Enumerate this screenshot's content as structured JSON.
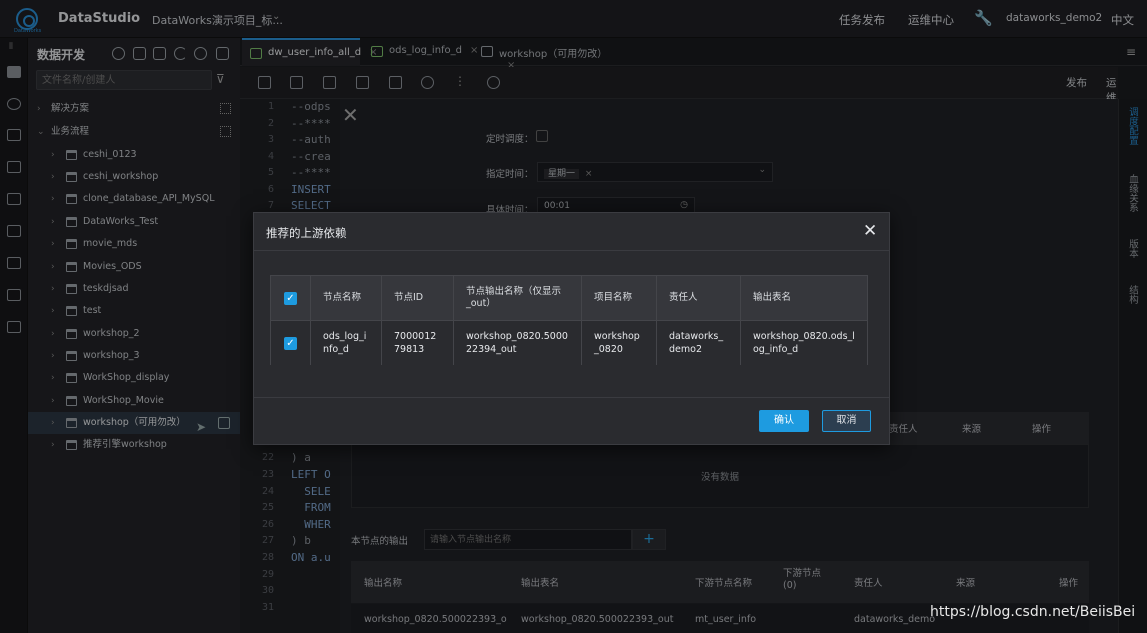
{
  "topbar": {
    "logo_sub": "DataWorks",
    "app_name": "DataStudio",
    "project": "DataWorks演示项目_标...",
    "nav_publish": "任务发布",
    "nav_ops": "运维中心",
    "user": "dataworks_demo2",
    "lang": "中文"
  },
  "sidebar": {
    "title": "数据开发",
    "search_placeholder": "文件名称/创建人",
    "groups": [
      {
        "label": "解决方案"
      },
      {
        "label": "业务流程"
      }
    ],
    "items": [
      {
        "label": "ceshi_0123"
      },
      {
        "label": "ceshi_workshop"
      },
      {
        "label": "clone_database_API_MySQL"
      },
      {
        "label": "DataWorks_Test"
      },
      {
        "label": "movie_mds"
      },
      {
        "label": "Movies_ODS"
      },
      {
        "label": "teskdjsad"
      },
      {
        "label": "test"
      },
      {
        "label": "workshop_2"
      },
      {
        "label": "workshop_3"
      },
      {
        "label": "WorkShop_display"
      },
      {
        "label": "WorkShop_Movie"
      },
      {
        "label": "workshop（可用勿改）"
      },
      {
        "label": "推荐引擎workshop"
      }
    ]
  },
  "tabs": [
    {
      "label": "dw_user_info_all_d"
    },
    {
      "label": "ods_log_info_d"
    },
    {
      "label": "workshop（可用勿改）"
    }
  ],
  "toolbar": {
    "publish": "发布",
    "ops": "运维"
  },
  "editor": {
    "line_numbers": [
      "1",
      "2",
      "3",
      "4",
      "5",
      "6",
      "7",
      "22",
      "23",
      "24",
      "25",
      "26",
      "27",
      "28",
      "29",
      "30",
      "31"
    ],
    "lines": [
      "--odps",
      "--****",
      "--auth",
      "--crea",
      "--****",
      "INSERT",
      "SELECT",
      ") a",
      "LEFT O",
      "  SELE",
      "  FROM",
      "  WHER",
      ") b",
      "ON a.u"
    ]
  },
  "right_panel": [
    "调度配置",
    "血缘关系",
    "版本",
    "结构"
  ],
  "config": {
    "schedule_label": "定时调度：",
    "specify_time_label": "指定时间：",
    "weekday_tag": "星期一",
    "specific_time_label": "具体时间：",
    "time_value": "00:01",
    "upstream_headers_tail": [
      "责任人",
      "来源",
      "操作"
    ],
    "no_data": "没有数据",
    "output_label": "本节点的输出",
    "output_placeholder": "请输入节点输出名称",
    "add_symbol": "+",
    "output_headers": [
      "输出名称",
      "输出表名",
      "下游节点名称",
      "下游节点(0)",
      "责任人",
      "来源",
      "操作"
    ],
    "output_row": [
      "workshop_0820.500022393_o",
      "workshop_0820.500022393_out",
      "mt_user_info",
      "",
      "dataworks_demo",
      ""
    ]
  },
  "modal": {
    "title": "推荐的上游依赖",
    "headers": [
      "节点名称",
      "节点ID",
      "节点输出名称（仅显示_out）",
      "项目名称",
      "责任人",
      "输出表名"
    ],
    "row": [
      "ods_log_info_d",
      "700001279813",
      "workshop_0820.500022394_out",
      "workshop_0820",
      "dataworks_demo2",
      "workshop_0820.ods_log_info_d"
    ],
    "confirm": "确认",
    "cancel": "取消"
  },
  "watermark": "https://blog.csdn.net/BeiisBei"
}
